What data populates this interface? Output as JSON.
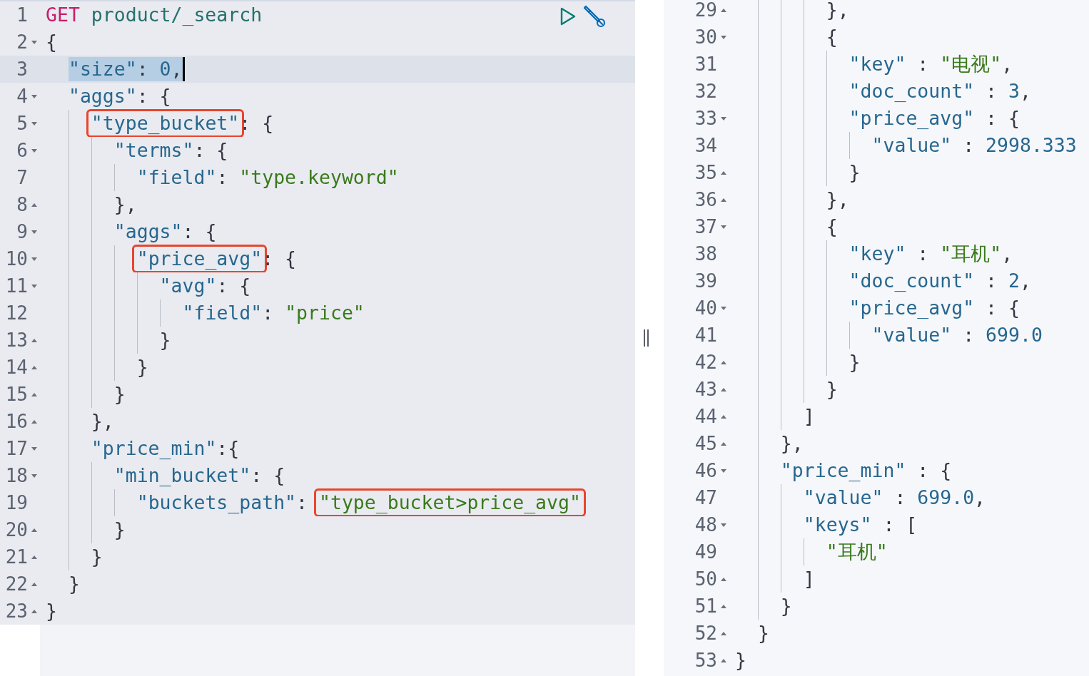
{
  "request_editor": {
    "lines": [
      {
        "number": "1",
        "fold_start": false,
        "fold_end": false,
        "tokens": [
          {
            "kind": "method",
            "text": "GET"
          },
          {
            "kind": "url",
            "text": " product/_search"
          }
        ]
      },
      {
        "number": "2",
        "fold_start": true,
        "fold_end": false,
        "tokens": [
          {
            "kind": "punct",
            "text": "{"
          }
        ]
      },
      {
        "number": "3",
        "fold_start": false,
        "fold_end": false,
        "active": true,
        "cursor": true,
        "tokens": [
          {
            "kind": "key",
            "text": "  \"size\"",
            "selected": true
          },
          {
            "kind": "punct",
            "text": ": ",
            "selected": true
          },
          {
            "kind": "number",
            "text": "0",
            "selected": true
          },
          {
            "kind": "punct",
            "text": ",",
            "selected": true
          }
        ]
      },
      {
        "number": "4",
        "fold_start": true,
        "fold_end": false,
        "tokens": [
          {
            "kind": "key",
            "text": "  \"aggs\""
          },
          {
            "kind": "punct",
            "text": ": {"
          }
        ]
      },
      {
        "number": "5",
        "fold_start": true,
        "fold_end": false,
        "tokens": [
          {
            "kind": "key",
            "text": "    \"type_bucket\"",
            "boxed": true
          },
          {
            "kind": "punct",
            "text": ": {"
          }
        ]
      },
      {
        "number": "6",
        "fold_start": true,
        "fold_end": false,
        "tokens": [
          {
            "kind": "key",
            "text": "      \"terms\""
          },
          {
            "kind": "punct",
            "text": ": {"
          }
        ]
      },
      {
        "number": "7",
        "fold_start": false,
        "fold_end": false,
        "tokens": [
          {
            "kind": "key",
            "text": "        \"field\""
          },
          {
            "kind": "punct",
            "text": ": "
          },
          {
            "kind": "string",
            "text": "\"type.keyword\""
          }
        ]
      },
      {
        "number": "8",
        "fold_start": false,
        "fold_end": true,
        "tokens": [
          {
            "kind": "punct",
            "text": "      },"
          }
        ]
      },
      {
        "number": "9",
        "fold_start": true,
        "fold_end": false,
        "tokens": [
          {
            "kind": "key",
            "text": "      \"aggs\""
          },
          {
            "kind": "punct",
            "text": ": {"
          }
        ]
      },
      {
        "number": "10",
        "fold_start": true,
        "fold_end": false,
        "tokens": [
          {
            "kind": "key",
            "text": "        \"price_avg\"",
            "boxed": true
          },
          {
            "kind": "punct",
            "text": ": {"
          }
        ]
      },
      {
        "number": "11",
        "fold_start": true,
        "fold_end": false,
        "tokens": [
          {
            "kind": "key",
            "text": "          \"avg\""
          },
          {
            "kind": "punct",
            "text": ": {"
          }
        ]
      },
      {
        "number": "12",
        "fold_start": false,
        "fold_end": false,
        "tokens": [
          {
            "kind": "key",
            "text": "            \"field\""
          },
          {
            "kind": "punct",
            "text": ": "
          },
          {
            "kind": "string",
            "text": "\"price\""
          }
        ]
      },
      {
        "number": "13",
        "fold_start": false,
        "fold_end": true,
        "tokens": [
          {
            "kind": "punct",
            "text": "          }"
          }
        ]
      },
      {
        "number": "14",
        "fold_start": false,
        "fold_end": true,
        "tokens": [
          {
            "kind": "punct",
            "text": "        }"
          }
        ]
      },
      {
        "number": "15",
        "fold_start": false,
        "fold_end": true,
        "tokens": [
          {
            "kind": "punct",
            "text": "      }"
          }
        ]
      },
      {
        "number": "16",
        "fold_start": false,
        "fold_end": true,
        "tokens": [
          {
            "kind": "punct",
            "text": "    },"
          }
        ]
      },
      {
        "number": "17",
        "fold_start": true,
        "fold_end": false,
        "tokens": [
          {
            "kind": "key",
            "text": "    \"price_min\""
          },
          {
            "kind": "punct",
            "text": ":{"
          }
        ]
      },
      {
        "number": "18",
        "fold_start": true,
        "fold_end": false,
        "tokens": [
          {
            "kind": "key",
            "text": "      \"min_bucket\""
          },
          {
            "kind": "punct",
            "text": ": {"
          }
        ]
      },
      {
        "number": "19",
        "fold_start": false,
        "fold_end": false,
        "tokens": [
          {
            "kind": "key",
            "text": "        \"buckets_path\""
          },
          {
            "kind": "punct",
            "text": ": "
          },
          {
            "kind": "string",
            "text": "\"type_bucket>price_avg\"",
            "boxed": true
          }
        ]
      },
      {
        "number": "20",
        "fold_start": false,
        "fold_end": true,
        "tokens": [
          {
            "kind": "punct",
            "text": "      }"
          }
        ]
      },
      {
        "number": "21",
        "fold_start": false,
        "fold_end": true,
        "tokens": [
          {
            "kind": "punct",
            "text": "    }"
          }
        ]
      },
      {
        "number": "22",
        "fold_start": false,
        "fold_end": true,
        "tokens": [
          {
            "kind": "punct",
            "text": "  }"
          }
        ]
      },
      {
        "number": "23",
        "fold_start": false,
        "fold_end": true,
        "tokens": [
          {
            "kind": "punct",
            "text": "}"
          }
        ]
      }
    ]
  },
  "response_viewer": {
    "lines": [
      {
        "number": "29",
        "fold_start": false,
        "fold_end": true,
        "tokens": [
          {
            "kind": "punct",
            "text": "        },"
          }
        ]
      },
      {
        "number": "30",
        "fold_start": true,
        "fold_end": false,
        "tokens": [
          {
            "kind": "punct",
            "text": "        {"
          }
        ]
      },
      {
        "number": "31",
        "fold_start": false,
        "fold_end": false,
        "tokens": [
          {
            "kind": "key",
            "text": "          \"key\""
          },
          {
            "kind": "punct",
            "text": " : "
          },
          {
            "kind": "string",
            "text": "\"电视\""
          },
          {
            "kind": "punct",
            "text": ","
          }
        ]
      },
      {
        "number": "32",
        "fold_start": false,
        "fold_end": false,
        "tokens": [
          {
            "kind": "key",
            "text": "          \"doc_count\""
          },
          {
            "kind": "punct",
            "text": " : "
          },
          {
            "kind": "number",
            "text": "3"
          },
          {
            "kind": "punct",
            "text": ","
          }
        ]
      },
      {
        "number": "33",
        "fold_start": true,
        "fold_end": false,
        "tokens": [
          {
            "kind": "key",
            "text": "          \"price_avg\""
          },
          {
            "kind": "punct",
            "text": " : {"
          }
        ]
      },
      {
        "number": "34",
        "fold_start": false,
        "fold_end": false,
        "tokens": [
          {
            "kind": "key",
            "text": "            \"value\""
          },
          {
            "kind": "punct",
            "text": " : "
          },
          {
            "kind": "number",
            "text": "2998.333"
          }
        ]
      },
      {
        "number": "35",
        "fold_start": false,
        "fold_end": true,
        "tokens": [
          {
            "kind": "punct",
            "text": "          }"
          }
        ]
      },
      {
        "number": "36",
        "fold_start": false,
        "fold_end": true,
        "tokens": [
          {
            "kind": "punct",
            "text": "        },"
          }
        ]
      },
      {
        "number": "37",
        "fold_start": true,
        "fold_end": false,
        "tokens": [
          {
            "kind": "punct",
            "text": "        {"
          }
        ]
      },
      {
        "number": "38",
        "fold_start": false,
        "fold_end": false,
        "tokens": [
          {
            "kind": "key",
            "text": "          \"key\""
          },
          {
            "kind": "punct",
            "text": " : "
          },
          {
            "kind": "string",
            "text": "\"耳机\""
          },
          {
            "kind": "punct",
            "text": ","
          }
        ]
      },
      {
        "number": "39",
        "fold_start": false,
        "fold_end": false,
        "tokens": [
          {
            "kind": "key",
            "text": "          \"doc_count\""
          },
          {
            "kind": "punct",
            "text": " : "
          },
          {
            "kind": "number",
            "text": "2"
          },
          {
            "kind": "punct",
            "text": ","
          }
        ]
      },
      {
        "number": "40",
        "fold_start": true,
        "fold_end": false,
        "tokens": [
          {
            "kind": "key",
            "text": "          \"price_avg\""
          },
          {
            "kind": "punct",
            "text": " : {"
          }
        ]
      },
      {
        "number": "41",
        "fold_start": false,
        "fold_end": false,
        "tokens": [
          {
            "kind": "key",
            "text": "            \"value\""
          },
          {
            "kind": "punct",
            "text": " : "
          },
          {
            "kind": "number",
            "text": "699.0"
          }
        ]
      },
      {
        "number": "42",
        "fold_start": false,
        "fold_end": true,
        "tokens": [
          {
            "kind": "punct",
            "text": "          }"
          }
        ]
      },
      {
        "number": "43",
        "fold_start": false,
        "fold_end": true,
        "tokens": [
          {
            "kind": "punct",
            "text": "        }"
          }
        ]
      },
      {
        "number": "44",
        "fold_start": false,
        "fold_end": true,
        "tokens": [
          {
            "kind": "punct",
            "text": "      ]"
          }
        ]
      },
      {
        "number": "45",
        "fold_start": false,
        "fold_end": true,
        "tokens": [
          {
            "kind": "punct",
            "text": "    },"
          }
        ]
      },
      {
        "number": "46",
        "fold_start": true,
        "fold_end": false,
        "tokens": [
          {
            "kind": "key",
            "text": "    \"price_min\""
          },
          {
            "kind": "punct",
            "text": " : {"
          }
        ]
      },
      {
        "number": "47",
        "fold_start": false,
        "fold_end": false,
        "tokens": [
          {
            "kind": "key",
            "text": "      \"value\""
          },
          {
            "kind": "punct",
            "text": " : "
          },
          {
            "kind": "number",
            "text": "699.0"
          },
          {
            "kind": "punct",
            "text": ","
          }
        ]
      },
      {
        "number": "48",
        "fold_start": true,
        "fold_end": false,
        "tokens": [
          {
            "kind": "key",
            "text": "      \"keys\""
          },
          {
            "kind": "punct",
            "text": " : ["
          }
        ]
      },
      {
        "number": "49",
        "fold_start": false,
        "fold_end": false,
        "tokens": [
          {
            "kind": "string",
            "text": "        \"耳机\""
          }
        ]
      },
      {
        "number": "50",
        "fold_start": false,
        "fold_end": true,
        "tokens": [
          {
            "kind": "punct",
            "text": "      ]"
          }
        ]
      },
      {
        "number": "51",
        "fold_start": false,
        "fold_end": true,
        "tokens": [
          {
            "kind": "punct",
            "text": "    }"
          }
        ]
      },
      {
        "number": "52",
        "fold_start": false,
        "fold_end": true,
        "tokens": [
          {
            "kind": "punct",
            "text": "  }"
          }
        ]
      },
      {
        "number": "53",
        "fold_start": false,
        "fold_end": true,
        "tokens": [
          {
            "kind": "punct",
            "text": "}"
          }
        ]
      }
    ]
  }
}
